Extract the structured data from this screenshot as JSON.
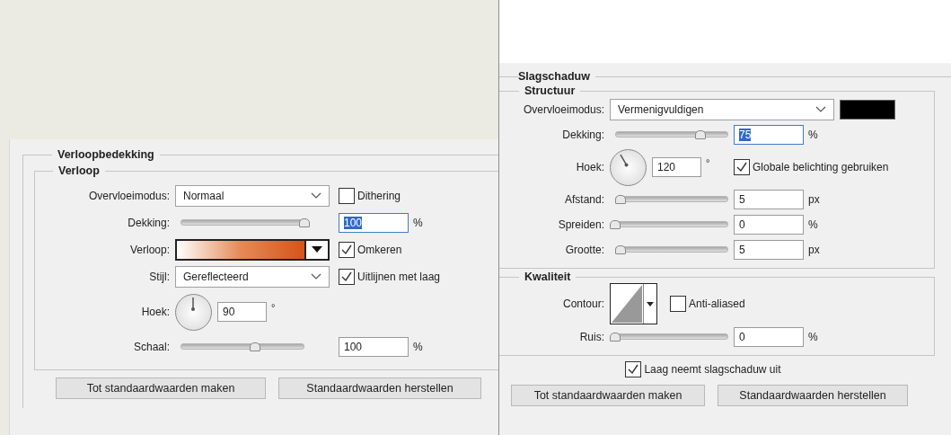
{
  "panels": [
    {
      "title": "Verloopbedekking",
      "groups": [
        {
          "title": "Verloop",
          "rows": [
            {
              "kind": "dropdown",
              "label": "Overvloeimodus:",
              "value": "Normaal",
              "checkbox": {
                "label": "Dithering",
                "checked": false
              }
            },
            {
              "kind": "slider",
              "label": "Dekking:",
              "level": 1.0,
              "value": "100",
              "selected": true,
              "unit": "%"
            },
            {
              "kind": "gradient",
              "label": "Verloop:",
              "checkbox": {
                "label": "Omkeren",
                "checked": true
              }
            },
            {
              "kind": "dropdown",
              "label": "Stijl:",
              "value": "Gereflecteerd",
              "checkbox": {
                "label": "Uitlijnen met laag",
                "checked": true
              }
            },
            {
              "kind": "angle",
              "label": "Hoek:",
              "value": "90",
              "unit": "°"
            },
            {
              "kind": "slider",
              "label": "Schaal:",
              "level": 0.6,
              "value": "100",
              "selected": false,
              "unit": "%"
            }
          ]
        }
      ],
      "buttons": [
        "Tot standaardwaarden maken",
        "Standaardwaarden herstellen"
      ]
    },
    {
      "title": "Slagschaduw",
      "groups": [
        {
          "title": "Structuur",
          "rows": [
            {
              "kind": "dropdown",
              "label": "Overvloeimodus:",
              "value": "Vermenigvuldigen",
              "swatch": {
                "color": "#000000"
              }
            },
            {
              "kind": "slider",
              "label": "Dekking:",
              "level": 0.75,
              "value": "75",
              "selected": true,
              "unit": "%"
            },
            {
              "kind": "angle",
              "label": "Hoek:",
              "value": "120",
              "unit": "°",
              "checkbox": {
                "label": "Globale belichting gebruiken",
                "checked": true
              }
            },
            {
              "kind": "slider",
              "label": "Afstand:",
              "level": 0.05,
              "value": "5",
              "selected": false,
              "unit": "px"
            },
            {
              "kind": "slider",
              "label": "Spreiden:",
              "level": 0,
              "value": "0",
              "selected": false,
              "unit": "%"
            },
            {
              "kind": "slider",
              "label": "Grootte:",
              "level": 0.05,
              "value": "5",
              "selected": false,
              "unit": "px"
            }
          ]
        },
        {
          "title": "Kwaliteit",
          "rows": [
            {
              "kind": "contour",
              "label": "Contour:",
              "checkbox": {
                "label": "Anti-aliased",
                "checked": false
              }
            },
            {
              "kind": "slider",
              "label": "Ruis:",
              "level": 0,
              "value": "0",
              "selected": false,
              "unit": "%"
            }
          ]
        }
      ],
      "footer_checkbox": {
        "label": "Laag neemt slagschaduw uit",
        "checked": true
      },
      "buttons": [
        "Tot standaardwaarden maken",
        "Standaardwaarden herstellen"
      ]
    }
  ]
}
